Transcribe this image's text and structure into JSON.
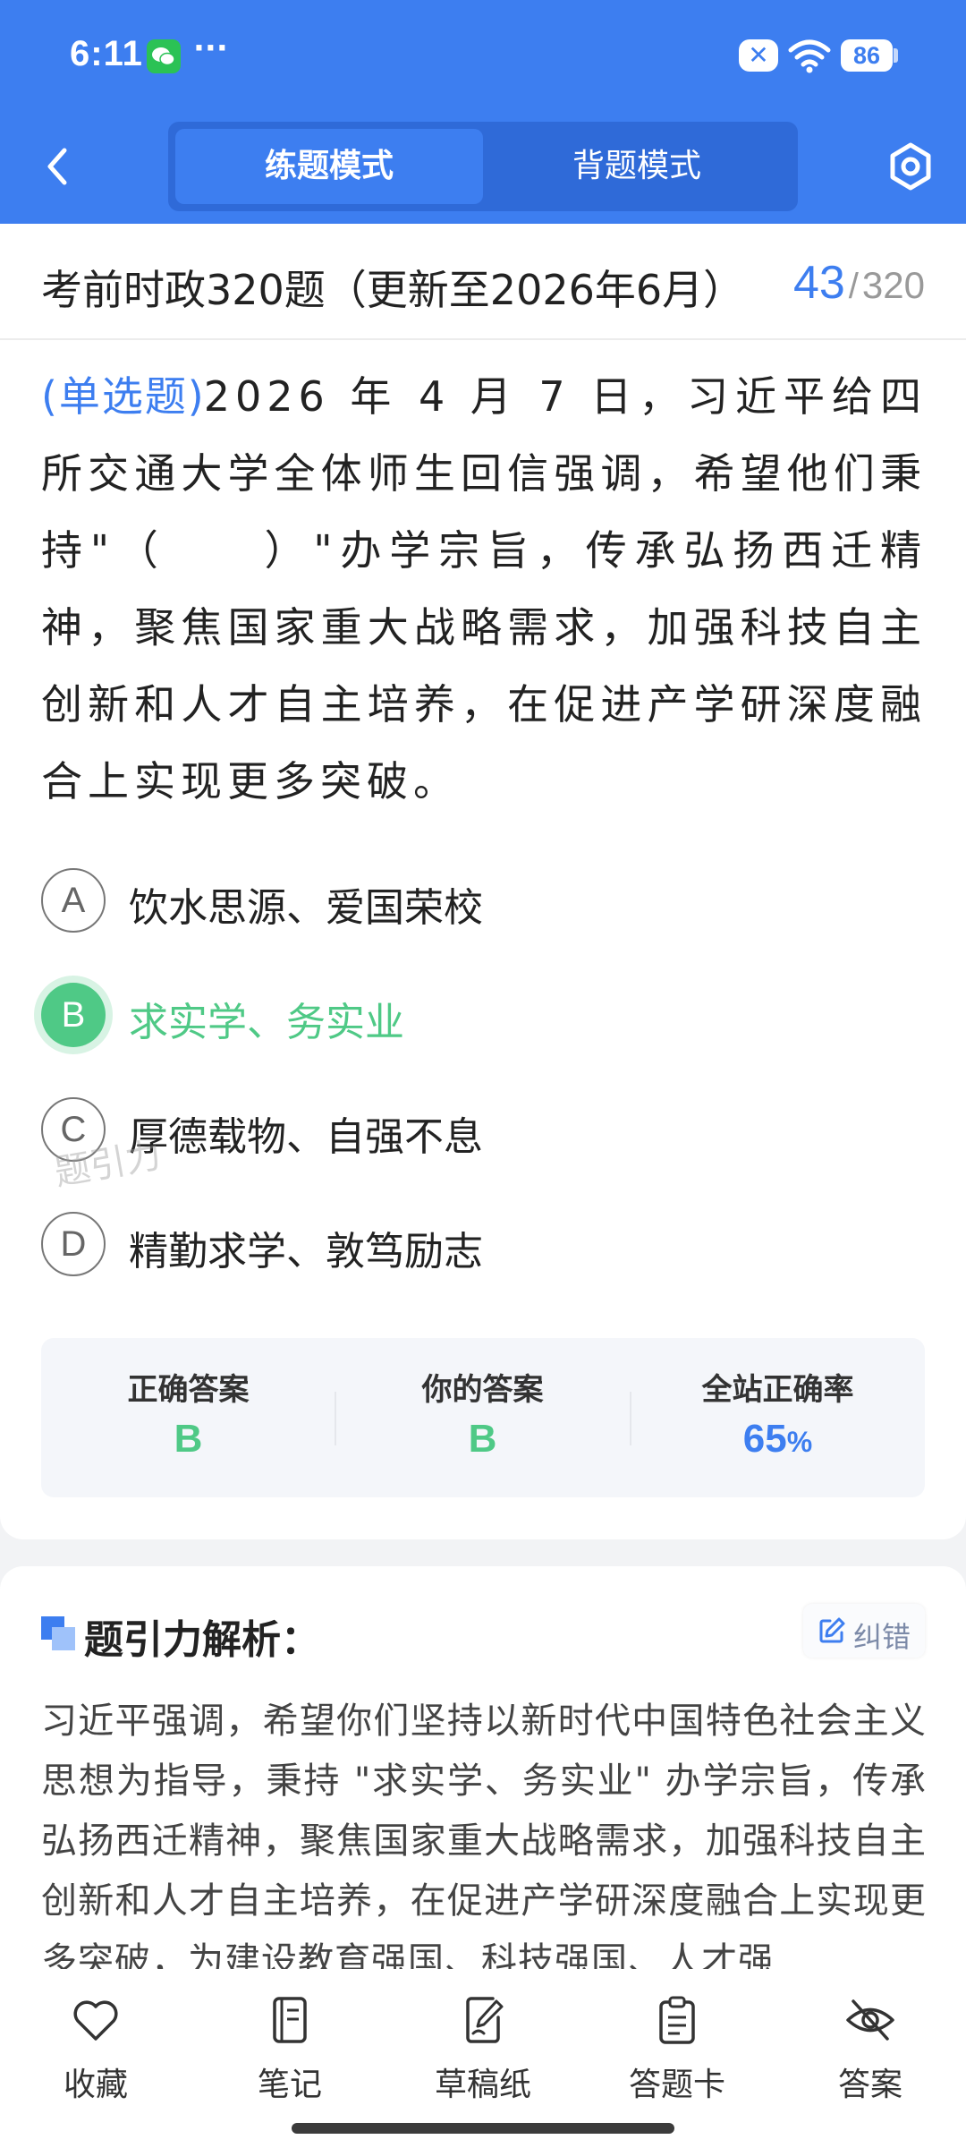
{
  "status_bar": {
    "time": "6:11",
    "dots": "···",
    "battery": "86"
  },
  "nav": {
    "tab_practice": "练题模式",
    "tab_recite": "背题模式"
  },
  "paper": {
    "title": "考前时政320题（更新至2026年6月）",
    "current": "43",
    "separator": "/",
    "total": "320"
  },
  "question": {
    "type_label": "(单选题)",
    "text": "2026 年 4 月 7 日，习近平给四所交通大学全体师生回信强调，希望他们秉持\"（　　）\"办学宗旨，传承弘扬西迁精神，聚焦国家重大战略需求，加强科技自主创新和人才自主培养，在促进产学研深度融合上实现更多突破。"
  },
  "options": [
    {
      "letter": "A",
      "text": "饮水思源、爱国荣校"
    },
    {
      "letter": "B",
      "text": "求实学、务实业"
    },
    {
      "letter": "C",
      "text": "厚德载物、自强不息"
    },
    {
      "letter": "D",
      "text": "精勤求学、敦笃励志"
    }
  ],
  "watermark": "题引力",
  "answers": {
    "correct_label": "正确答案",
    "correct_value": "B",
    "yours_label": "你的答案",
    "yours_value": "B",
    "rate_label": "全站正确率",
    "rate_value": "65",
    "rate_unit": "%"
  },
  "analysis": {
    "title": "题引力解析：",
    "report_label": "纠错",
    "text": "习近平强调，希望你们坚持以新时代中国特色社会主义思想为指导，秉持 \"求实学、务实业\" 办学宗旨，传承弘扬西迁精神，聚焦国家重大战略需求，加强科技自主创新和人才自主培养，在促进产学研深度融合上实现更多突破，为建设教育强国、科技强国、人才强"
  },
  "bottom_bar": {
    "favorite": "收藏",
    "notes": "笔记",
    "draft": "草稿纸",
    "answer_card": "答题卡",
    "answer": "答案"
  },
  "colors": {
    "primary": "#3d7ef0",
    "correct": "#4fc986"
  }
}
